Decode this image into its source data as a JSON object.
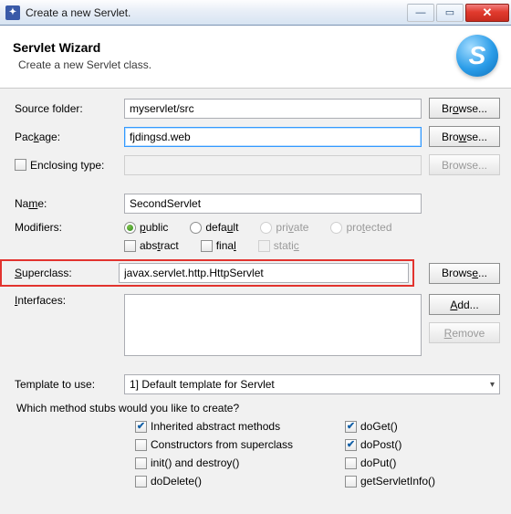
{
  "window": {
    "title": "Create a new Servlet."
  },
  "banner": {
    "heading": "Servlet Wizard",
    "sub": "Create a new Servlet class.",
    "badge": "S"
  },
  "labels": {
    "sourceFolder": "Source folder:",
    "package": "Package:",
    "enclosingType": "Enclosing type:",
    "name": "Name:",
    "modifiers": "Modifiers:",
    "superclass": "Superclass:",
    "interfaces": "Interfaces:",
    "template": "Template to use:",
    "methodsQ": "Which method stubs would you like to create?"
  },
  "values": {
    "sourceFolder": "myservlet/src",
    "package": "fjdingsd.web",
    "enclosingType": "",
    "name": "SecondServlet",
    "superclass": "javax.servlet.http.HttpServlet",
    "template": "1] Default template for Servlet"
  },
  "buttons": {
    "browse": "Browse...",
    "add": "Add...",
    "remove": "Remove"
  },
  "modifiers": {
    "public": "public",
    "default": "default",
    "private": "private",
    "protected": "protected",
    "abstract": "abstract",
    "final": "final",
    "static": "static"
  },
  "methods": {
    "inherited": "Inherited abstract methods",
    "constructors": "Constructors from superclass",
    "initDestroy": "init() and destroy()",
    "doDelete": "doDelete()",
    "doGet": "doGet()",
    "doPost": "doPost()",
    "doPut": "doPut()",
    "getServletInfo": "getServletInfo()"
  }
}
